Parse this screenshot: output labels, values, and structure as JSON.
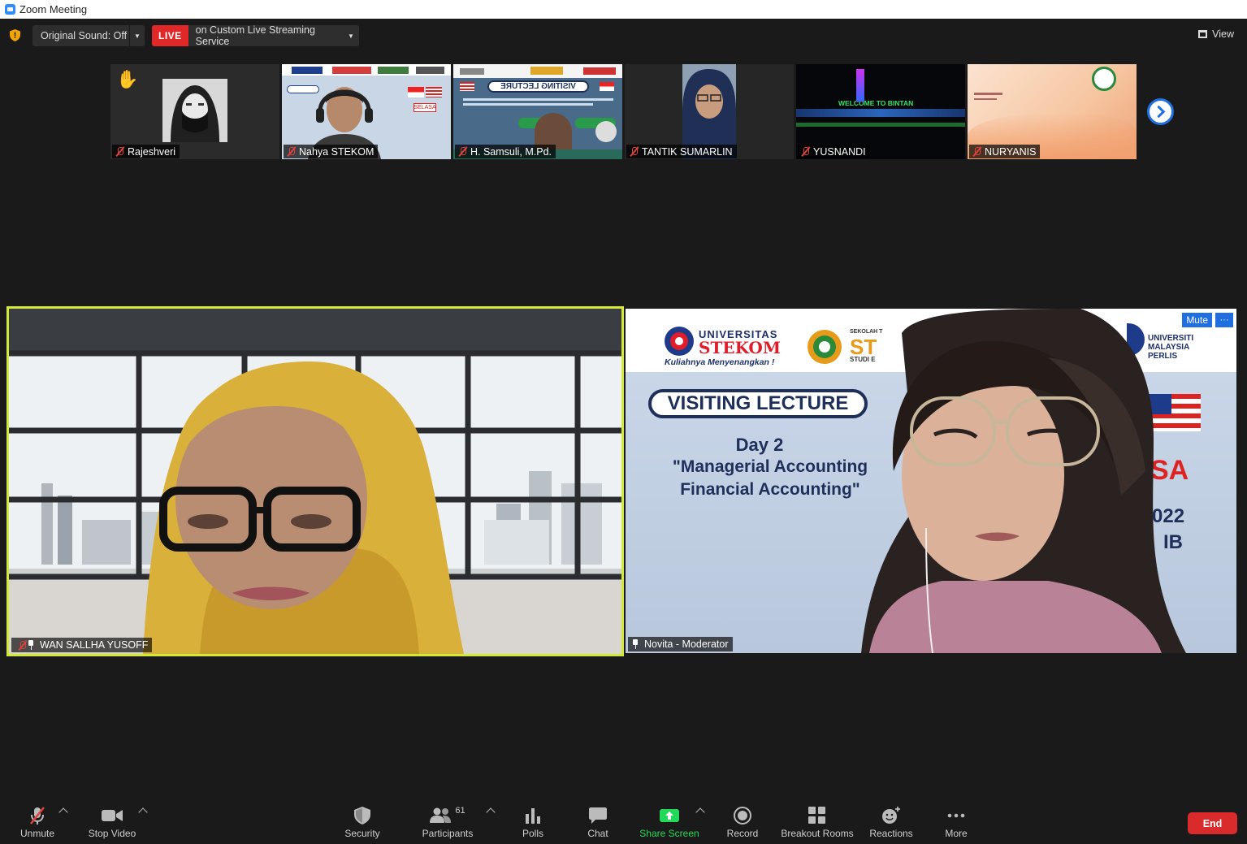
{
  "window": {
    "title": "Zoom Meeting"
  },
  "topbar": {
    "original_sound": "Original Sound: Off",
    "live_badge": "LIVE",
    "live_service": "on Custom Live Streaming Service",
    "view": "View"
  },
  "strip": [
    {
      "name": "Rajeshveri",
      "hand_raised": true
    },
    {
      "name": "Nahya STEKOM"
    },
    {
      "name": "H. Samsuli, M.Pd."
    },
    {
      "name": "TANTIK SUMARLIN"
    },
    {
      "name": "YUSNANDI"
    },
    {
      "name": "NURYANIS"
    }
  ],
  "main": {
    "left": {
      "name": "WAN SALLHA YUSOFF",
      "active_speaker": true
    },
    "right": {
      "name": "Novita - Moderator",
      "mute_label": "Mute",
      "more_label": "···",
      "background": {
        "uni_name": "UNIVERSITAS",
        "uni_brand": "STEKOM",
        "uni_tagline": "Kuliahnya Menyenangkan !",
        "school_small": "SEKOLAH T",
        "school_brand": "ST",
        "school_sub": "STUDI E",
        "partner_1": "UNIVERSITI",
        "partner_2": "MALAYSIA",
        "partner_3": "PERLIS",
        "banner": "VISITING LECTURE",
        "day": "Day 2",
        "topic_1": "\"Managerial Accounting",
        "topic_2": "Financial Accounting\"",
        "side_1": "SA",
        "side_2": "022",
        "side_3": "IB"
      }
    }
  },
  "thumb_text": {
    "welcome_sign": "WELCOME TO BINTAN",
    "vl_mirror": "VISITING LECTURE",
    "selasa": "SELASA"
  },
  "toolbar": {
    "unmute": "Unmute",
    "stop_video": "Stop Video",
    "security": "Security",
    "participants": "Participants",
    "participants_count": "61",
    "polls": "Polls",
    "chat": "Chat",
    "share_screen": "Share Screen",
    "record": "Record",
    "breakout_rooms": "Breakout Rooms",
    "reactions": "Reactions",
    "more": "More",
    "end": "End"
  },
  "colors": {
    "accent": "#2d8cff",
    "live_red": "#e02828",
    "active_speaker": "#d4e83a",
    "share_green": "#23d959",
    "end_red": "#d92b2b"
  }
}
